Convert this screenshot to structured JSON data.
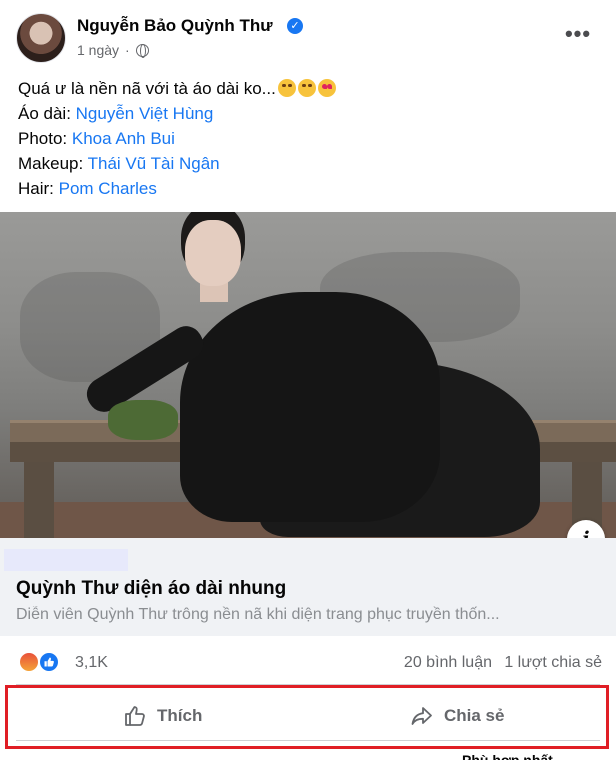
{
  "post": {
    "author": "Nguyễn Bảo Quỳnh Thư",
    "verified_badge": "✓",
    "time": "1 ngày",
    "separator": "·",
    "privacy_icon": "globe-icon",
    "more_label": "•••"
  },
  "caption": {
    "line1": "Quá ư là nền nã với tà áo dài ko...",
    "line1_emojis": [
      "laughing",
      "smiling",
      "heart-eyes"
    ],
    "credits": [
      {
        "label": "Áo dài: ",
        "name": "Nguyễn Việt Hùng"
      },
      {
        "label": "Photo: ",
        "name": "Khoa Anh Bui"
      },
      {
        "label": "Makeup: ",
        "name": "Thái Vũ Tài Ngân"
      },
      {
        "label": "Hair: ",
        "name": "Pom Charles"
      }
    ]
  },
  "photo": {
    "info_label": "i"
  },
  "link_preview": {
    "title": "Quỳnh Thư diện áo dài nhung",
    "description": "Diễn viên Quỳnh Thư trông nền nã khi diện trang phục truyền thốn..."
  },
  "stats": {
    "reaction_icons": [
      "angry",
      "like"
    ],
    "reaction_count": "3,1K",
    "comments": "20 bình luận",
    "shares": "1 lượt chia sẻ"
  },
  "actions": {
    "like_label": "Thích",
    "share_label": "Chia sẻ"
  },
  "footer": {
    "partial_text": "Phù hợp nhất"
  },
  "colors": {
    "link": "#1877f2",
    "secondary_text": "#65676b",
    "highlight": "#e01e25",
    "preview_bg": "#f0f2f5"
  }
}
